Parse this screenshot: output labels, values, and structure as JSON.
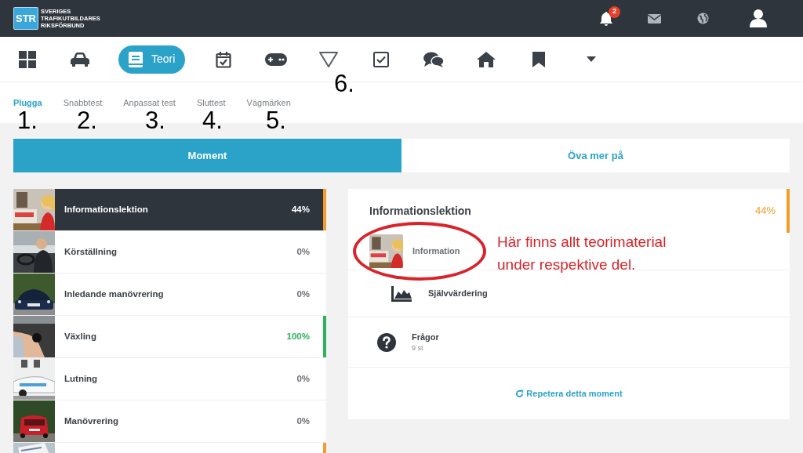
{
  "header": {
    "logo": "STR",
    "org_lines": [
      "SVERIGES",
      "TRAFIKUTBILDARES",
      "RIKSFÖRBUND"
    ],
    "notifications": "2"
  },
  "nav": [
    {
      "kind": "grid",
      "selected": false
    },
    {
      "kind": "car",
      "selected": false
    },
    {
      "kind": "book",
      "label": "Teori",
      "selected": true
    },
    {
      "kind": "calendar",
      "selected": false
    },
    {
      "kind": "gamepad",
      "selected": false
    },
    {
      "kind": "triangle",
      "selected": false
    },
    {
      "kind": "checkbox",
      "selected": false
    },
    {
      "kind": "chat",
      "selected": false
    },
    {
      "kind": "home",
      "selected": false
    },
    {
      "kind": "bookmark",
      "selected": false
    },
    {
      "kind": "caret",
      "selected": false
    }
  ],
  "subtabs": [
    {
      "label": "Plugga",
      "selected": true
    },
    {
      "label": "Snabbtest",
      "selected": false
    },
    {
      "label": "Anpassat test",
      "selected": false
    },
    {
      "label": "Sluttest",
      "selected": false
    },
    {
      "label": "Vägmärken",
      "selected": false
    }
  ],
  "segments": [
    {
      "label": "Moment",
      "selected": true
    },
    {
      "label": "Öva mer på",
      "selected": false
    }
  ],
  "moments": [
    {
      "title": "Informationslektion",
      "percent": "44%",
      "color": "#f39c2b",
      "selected": true
    },
    {
      "title": "Körställning",
      "percent": "0%",
      "selected": false
    },
    {
      "title": "Inledande manövrering",
      "percent": "0%",
      "selected": false
    },
    {
      "title": "Växling",
      "percent": "100%",
      "color": "#2cb35c",
      "selected": false
    },
    {
      "title": "Lutning",
      "percent": "0%",
      "selected": false
    },
    {
      "title": "Manövrering",
      "percent": "0%",
      "selected": false
    },
    {
      "color": "#f39c2b",
      "selected": false
    }
  ],
  "detail": {
    "title": "Informationslektion",
    "percent": "44%",
    "color": "#f39c2b",
    "items": [
      {
        "kind": "thumbnail",
        "label": "Information"
      },
      {
        "kind": "chart",
        "label": "Självvärdering"
      },
      {
        "kind": "question",
        "label": "Frågor",
        "sub": "9 st"
      }
    ],
    "repeat_link": "Repetera detta moment"
  },
  "annotations": {
    "numbers": [
      "1.",
      "2.",
      "3.",
      "4.",
      "5.",
      "6."
    ],
    "note_lines": [
      "Här finns allt teorimaterial",
      "under respektive del."
    ]
  }
}
